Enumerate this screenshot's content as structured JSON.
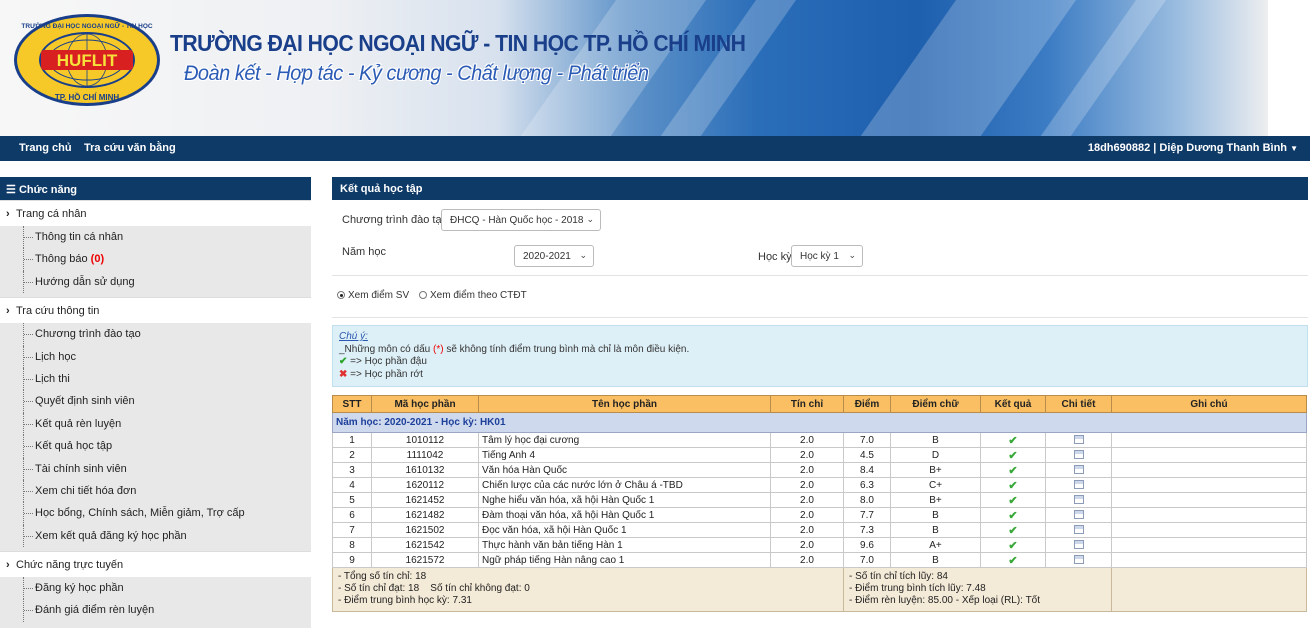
{
  "banner": {
    "logo_text": "HUFLIT",
    "logo_ring_top": "TRƯỜNG ĐẠI HỌC NGOẠI NGỮ - TIN HỌC",
    "logo_ring_bottom": "TP. HỒ CHÍ MINH",
    "school_name": "TRƯỜNG ĐẠI HỌC NGOẠI NGỮ - TIN HỌC TP. HỒ CHÍ MINH",
    "slogan": "Đoàn kết - Hợp tác - Kỷ cương - Chất lượng - Phát triển"
  },
  "navbar": {
    "home": "Trang chủ",
    "degree_lookup": "Tra cứu văn bằng",
    "user": "18dh690882 | Diệp Dương Thanh Bình"
  },
  "sidebar": {
    "header": "Chức năng",
    "groups": [
      {
        "label": "Trang cá nhân",
        "items": [
          {
            "label": "Thông tin cá nhân"
          },
          {
            "label": "Thông báo",
            "count": "(0)"
          },
          {
            "label": "Hướng dẫn sử dụng"
          }
        ]
      },
      {
        "label": "Tra cứu thông tin",
        "items": [
          {
            "label": "Chương trình đào tạo"
          },
          {
            "label": "Lịch học"
          },
          {
            "label": "Lịch thi"
          },
          {
            "label": "Quyết định sinh viên"
          },
          {
            "label": "Kết quả rèn luyện"
          },
          {
            "label": "Kết quả học tập"
          },
          {
            "label": "Tài chính sinh viên"
          },
          {
            "label": "Xem chi tiết hóa đơn"
          },
          {
            "label": "Học bổng, Chính sách, Miễn giảm, Trợ cấp"
          },
          {
            "label": "Xem kết quả đăng ký học phần"
          }
        ]
      },
      {
        "label": "Chức năng trực tuyến",
        "items": [
          {
            "label": "Đăng ký học phần"
          },
          {
            "label": "Đánh giá điểm rèn luyện"
          }
        ]
      }
    ]
  },
  "main": {
    "header": "Kết quả học tập",
    "program_label": "Chương trình đào tạo",
    "program_value": "ĐHCQ - Hàn Quốc học - 2018",
    "year_label": "Năm học",
    "year_value": "2020-2021",
    "term_label": "Học kỳ",
    "term_value": "Học kỳ 1",
    "radio_student": "Xem điểm SV",
    "radio_program": "Xem điểm theo CTĐT",
    "note": {
      "title": "Chú ý:",
      "line1_prefix": "_Những môn có dấu ",
      "line1_mark": "(*)",
      "line1_suffix": " sẽ không tính điểm trung bình mà chỉ là môn điều kiện.",
      "pass": "=> Học phần đậu",
      "fail": "=> Học phần rớt"
    },
    "table": {
      "headers": [
        "STT",
        "Mã học phần",
        "Tên học phần",
        "Tín chỉ",
        "Điểm",
        "Điểm chữ",
        "Kết quả",
        "Chi tiết",
        "Ghi chú"
      ],
      "semester_label": "Năm học: 2020-2021 - Học kỳ: HK01",
      "rows": [
        {
          "stt": "1",
          "code": "1010112",
          "name": "Tâm lý học đại cương",
          "credits": "2.0",
          "score": "7.0",
          "letter": "B"
        },
        {
          "stt": "2",
          "code": "1111042",
          "name": "Tiếng Anh 4",
          "credits": "2.0",
          "score": "4.5",
          "letter": "D"
        },
        {
          "stt": "3",
          "code": "1610132",
          "name": "Văn hóa Hàn Quốc",
          "credits": "2.0",
          "score": "8.4",
          "letter": "B+"
        },
        {
          "stt": "4",
          "code": "1620112",
          "name": "Chiến lược của các nước lớn ở Châu á -TBD",
          "credits": "2.0",
          "score": "6.3",
          "letter": "C+"
        },
        {
          "stt": "5",
          "code": "1621452",
          "name": "Nghe hiểu văn hóa, xã hội Hàn Quốc 1",
          "credits": "2.0",
          "score": "8.0",
          "letter": "B+"
        },
        {
          "stt": "6",
          "code": "1621482",
          "name": "Đàm thoại văn hóa, xã hội Hàn Quốc 1",
          "credits": "2.0",
          "score": "7.7",
          "letter": "B"
        },
        {
          "stt": "7",
          "code": "1621502",
          "name": "Đọc văn hóa, xã hội Hàn Quốc 1",
          "credits": "2.0",
          "score": "7.3",
          "letter": "B"
        },
        {
          "stt": "8",
          "code": "1621542",
          "name": "Thực hành văn bản tiếng Hàn 1",
          "credits": "2.0",
          "score": "9.6",
          "letter": "A+"
        },
        {
          "stt": "9",
          "code": "1621572",
          "name": "Ngữ pháp tiếng Hàn nâng cao 1",
          "credits": "2.0",
          "score": "7.0",
          "letter": "B"
        }
      ],
      "summary": {
        "total_credits": "- Tổng số tín chỉ: 18",
        "passed_credits": "- Số tín chỉ đạt: 18",
        "failed_credits": "Số tín chỉ không đạt: 0",
        "term_gpa": "- Điểm trung bình học kỳ: 7.31",
        "accum_credits": "- Số tín chỉ tích lũy: 84",
        "accum_gpa": "- Điểm trung bình tích lũy: 7.48",
        "conduct": "- Điểm rèn luyện: 85.00 - Xếp loại (RL): Tốt"
      }
    }
  },
  "colors": {
    "nav": "#0e3a68",
    "table_header": "#f9bf62",
    "semester_row": "#cfd9ee",
    "note_bg": "#def0f7",
    "summary_bg": "#f4ead8"
  }
}
